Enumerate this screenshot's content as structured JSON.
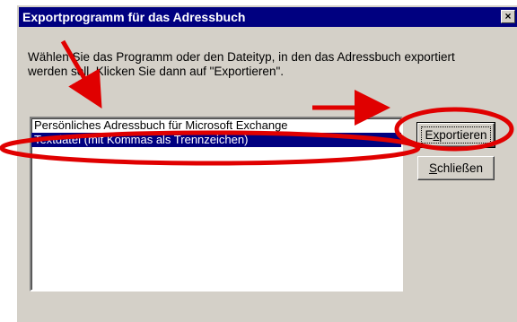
{
  "window": {
    "title": "Exportprogramm für das Adressbuch",
    "close_glyph": "×"
  },
  "description": "Wählen Sie das Programm oder den Dateityp, in den das Adressbuch exportiert werden soll. Klicken Sie dann auf \"Exportieren\".",
  "list": {
    "items": [
      {
        "label": "Persönliches Adressbuch für Microsoft Exchange",
        "selected": false
      },
      {
        "label": "Textdatei (mit Kommas als Trennzeichen)",
        "selected": true
      }
    ]
  },
  "buttons": {
    "export_pre": "E",
    "export_accel": "x",
    "export_post": "portieren",
    "close_accel": "S",
    "close_post": "chließen"
  },
  "annotations": {
    "color": "#e00000"
  }
}
